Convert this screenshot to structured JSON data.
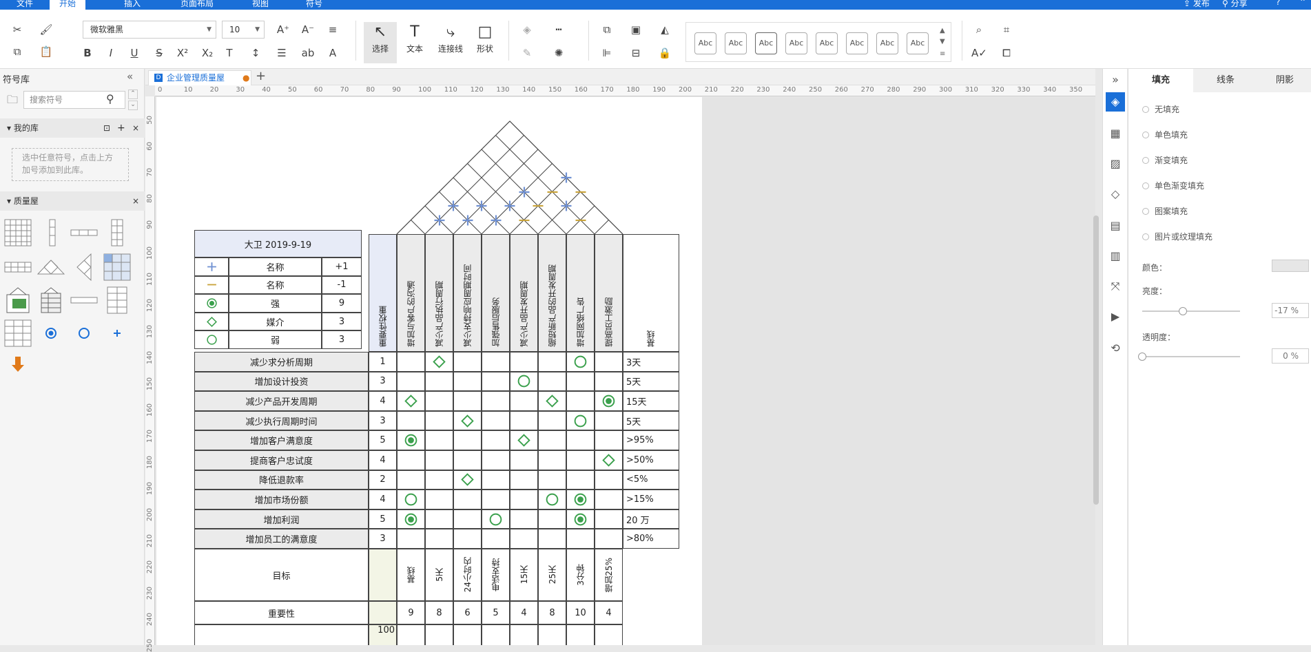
{
  "menu": {
    "items": [
      "文件",
      "开始",
      "插入",
      "页面布局",
      "视图",
      "符号"
    ],
    "active": "开始",
    "right": [
      "发布",
      "分享",
      "?"
    ]
  },
  "ribbon": {
    "font_name": "微软雅黑",
    "font_size": "10",
    "tools": {
      "select": "选择",
      "text": "文本",
      "connector": "连接线",
      "shape": "形状"
    },
    "style_presets": [
      "Abc",
      "Abc",
      "Abc",
      "Abc",
      "Abc",
      "Abc",
      "Abc",
      "Abc"
    ]
  },
  "library": {
    "title": "符号库",
    "search_placeholder": "搜索符号",
    "my_library": "我的库",
    "my_library_hint": "选中任意符号，点击上方加号添加到此库。",
    "quality_house": "质量屋"
  },
  "document": {
    "tab": "企业管理质量屋"
  },
  "ruler": {
    "h": [
      "0",
      "10",
      "20",
      "30",
      "40",
      "50",
      "60",
      "70",
      "80",
      "90",
      "100",
      "110",
      "120",
      "130",
      "140",
      "150",
      "160",
      "170",
      "180",
      "190",
      "200",
      "210",
      "220",
      "230",
      "240",
      "250",
      "260",
      "270",
      "280",
      "290",
      "300",
      "310",
      "320",
      "330",
      "340",
      "350"
    ],
    "v": [
      "50",
      "60",
      "70",
      "80",
      "90",
      "100",
      "110",
      "120",
      "130",
      "140",
      "150",
      "160",
      "170",
      "180",
      "190",
      "200",
      "210",
      "220",
      "230",
      "240",
      "250"
    ]
  },
  "right_panel": {
    "tabs": [
      "填充",
      "线条",
      "阴影"
    ],
    "fill_options": [
      "无填充",
      "单色填充",
      "渐变填充",
      "单色渐变填充",
      "图案填充",
      "图片或纹理填充"
    ],
    "color_label": "颜色：",
    "brightness_label": "亮度：",
    "brightness_value": "-17 %",
    "brightness": -17,
    "transparency_label": "透明度：",
    "transparency_value": "0 %",
    "transparency": 0
  },
  "qfd": {
    "header_date": "大卫 2019-9-19",
    "legend": [
      {
        "symbol": "plus",
        "name": "名称",
        "value": "+1"
      },
      {
        "symbol": "minus",
        "name": "名称",
        "value": "-1"
      },
      {
        "symbol": "strong",
        "name": "强",
        "value": "9"
      },
      {
        "symbol": "medium",
        "name": "媒介",
        "value": "3"
      },
      {
        "symbol": "weak",
        "name": "弱",
        "value": "3"
      }
    ],
    "importance_header": "重要性权重",
    "baseline_header": "基线",
    "columns": [
      "增加与客户的沟通",
      "减少产品执行周期",
      "减少支持响应周期时间",
      "加强售后服务",
      "减少产品开发周期",
      "缩短新产品的开发周期",
      "增加网络广告",
      "提高员工激励"
    ],
    "rows": [
      {
        "name": "减少求分析周期",
        "weight": "1",
        "baseline": "3天",
        "marks": [
          "",
          "medium",
          "",
          "",
          "",
          "",
          "weak",
          ""
        ]
      },
      {
        "name": "增加设计投资",
        "weight": "3",
        "baseline": "5天",
        "marks": [
          "",
          "",
          "",
          "",
          "weak",
          "",
          "",
          ""
        ]
      },
      {
        "name": "减少产品开发周期",
        "weight": "4",
        "baseline": "15天",
        "marks": [
          "medium",
          "",
          "",
          "",
          "",
          "medium",
          "",
          "strong"
        ]
      },
      {
        "name": "减少执行周期时间",
        "weight": "3",
        "baseline": "5天",
        "marks": [
          "",
          "",
          "medium",
          "",
          "",
          "",
          "weak",
          ""
        ]
      },
      {
        "name": "增加客户满意度",
        "weight": "5",
        "baseline": ">95%",
        "marks": [
          "strong",
          "",
          "",
          "",
          "medium",
          "",
          "",
          ""
        ]
      },
      {
        "name": "提商客户忠试度",
        "weight": "4",
        "baseline": ">50%",
        "marks": [
          "",
          "",
          "",
          "",
          "",
          "",
          "",
          "medium"
        ]
      },
      {
        "name": "降低退款率",
        "weight": "2",
        "baseline": "<5%",
        "marks": [
          "",
          "",
          "medium",
          "",
          "",
          "",
          "",
          ""
        ]
      },
      {
        "name": "增加市场份额",
        "weight": "4",
        "baseline": ">15%",
        "marks": [
          "weak",
          "",
          "",
          "",
          "",
          "weak",
          "strong",
          ""
        ]
      },
      {
        "name": "增加利润",
        "weight": "5",
        "baseline": "20 万",
        "marks": [
          "strong",
          "",
          "",
          "weak",
          "",
          "",
          "strong",
          ""
        ]
      },
      {
        "name": "增加员工的满意度",
        "weight": "3",
        "baseline": ">80%",
        "marks": [
          "",
          "",
          "",
          "",
          "",
          "",
          "",
          ""
        ]
      }
    ],
    "target_label": "目标",
    "targets": [
      "基线",
      "5天",
      "24小时内",
      "电话支持",
      "15天",
      "25天",
      "3分钟",
      "增加25%"
    ],
    "importance_label": "重要性",
    "importance": [
      "9",
      "8",
      "6",
      "5",
      "4",
      "8",
      "10",
      "4"
    ],
    "chart_max_label": "100",
    "roof": [
      {
        "d": 2,
        "k": 1,
        "sym": "plus"
      },
      {
        "d": 2,
        "k": 2,
        "sym": "plus"
      },
      {
        "d": 3,
        "k": 3,
        "sym": "plus"
      },
      {
        "d": 4,
        "k": 4,
        "sym": "plus"
      },
      {
        "d": 1,
        "k": 3,
        "sym": "plus"
      },
      {
        "d": 1,
        "k": 4,
        "sym": "minus"
      },
      {
        "d": 1,
        "k": 1,
        "sym": "plus"
      },
      {
        "d": 1,
        "k": 2,
        "sym": "plus"
      },
      {
        "d": 2,
        "k": 3,
        "sym": "plus"
      },
      {
        "d": 2,
        "k": 4,
        "sym": "minus"
      },
      {
        "d": 3,
        "k": 4,
        "sym": "minus"
      },
      {
        "d": 1,
        "k": 6,
        "sym": "minus"
      },
      {
        "d": 2,
        "k": 5,
        "sym": "plus"
      },
      {
        "d": 3,
        "k": 5,
        "sym": "minus"
      }
    ]
  }
}
